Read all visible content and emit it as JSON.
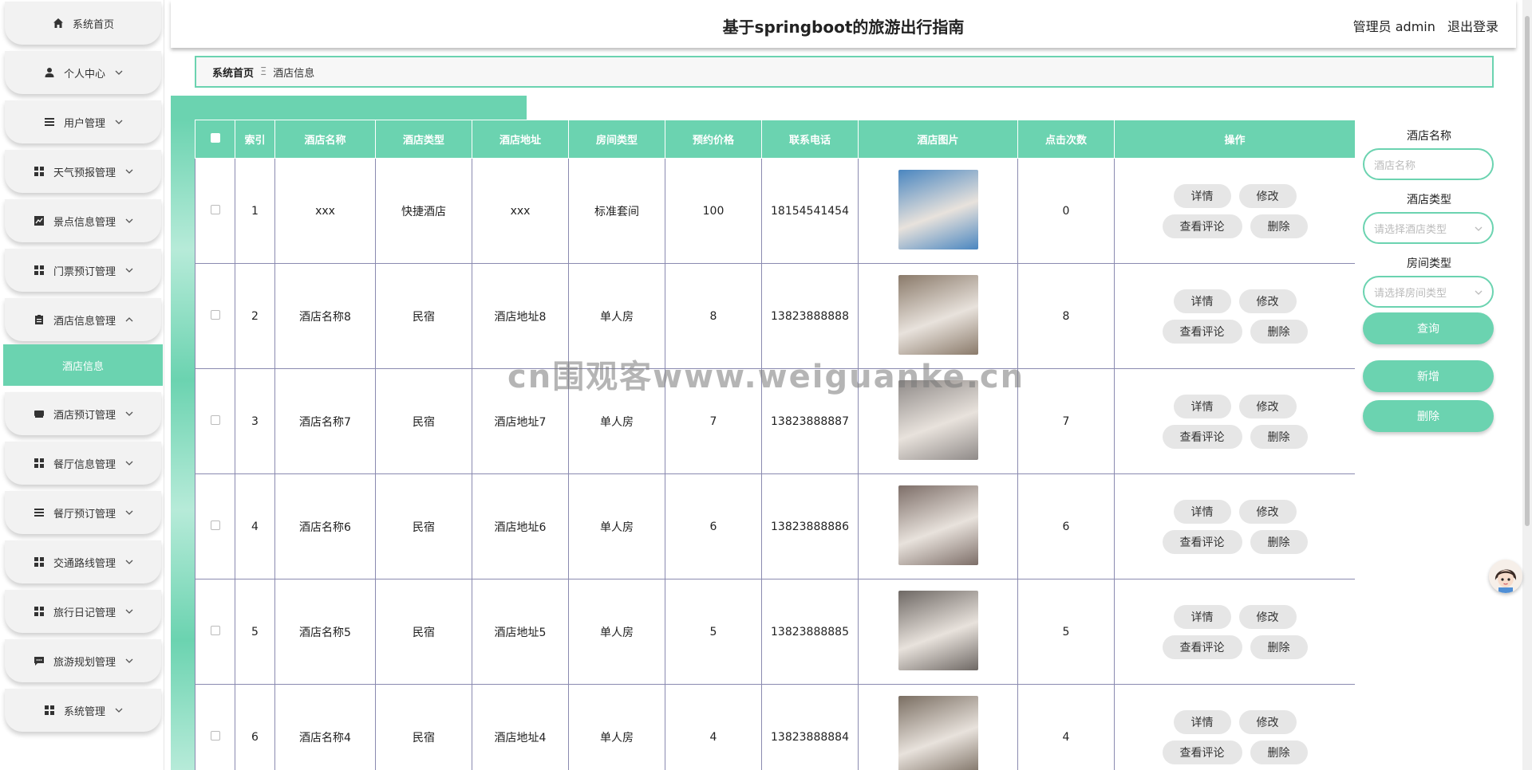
{
  "header": {
    "title": "基于springboot的旅游出行指南",
    "user_label": "管理员 admin",
    "logout_label": "退出登录"
  },
  "sidebar": {
    "items": [
      {
        "label": "系统首页",
        "icon": "home-icon",
        "has_chevron": false
      },
      {
        "label": "个人中心",
        "icon": "user-icon",
        "has_chevron": true
      },
      {
        "label": "用户管理",
        "icon": "list-icon",
        "has_chevron": true
      },
      {
        "label": "天气预报管理",
        "icon": "grid-icon",
        "has_chevron": true
      },
      {
        "label": "景点信息管理",
        "icon": "chart-icon",
        "has_chevron": true
      },
      {
        "label": "门票预订管理",
        "icon": "grid-icon",
        "has_chevron": true
      },
      {
        "label": "酒店信息管理",
        "icon": "clipboard-icon",
        "has_chevron": true,
        "expanded": true
      },
      {
        "label": "酒店预订管理",
        "icon": "drive-icon",
        "has_chevron": true
      },
      {
        "label": "餐厅信息管理",
        "icon": "grid-icon",
        "has_chevron": true
      },
      {
        "label": "餐厅预订管理",
        "icon": "list-icon",
        "has_chevron": true
      },
      {
        "label": "交通路线管理",
        "icon": "grid-icon",
        "has_chevron": true
      },
      {
        "label": "旅行日记管理",
        "icon": "grid-icon",
        "has_chevron": true
      },
      {
        "label": "旅游规划管理",
        "icon": "chat-icon",
        "has_chevron": true
      },
      {
        "label": "系统管理",
        "icon": "grid-icon",
        "has_chevron": true
      }
    ],
    "active_sub": "酒店信息"
  },
  "breadcrumb": {
    "home": "系统首页",
    "separator": "Ξ",
    "current": "酒店信息"
  },
  "table": {
    "columns": [
      "索引",
      "酒店名称",
      "酒店类型",
      "酒店地址",
      "房间类型",
      "预约价格",
      "联系电话",
      "酒店图片",
      "点击次数",
      "操作"
    ],
    "rows": [
      {
        "index": "1",
        "name": "xxx",
        "type": "快捷酒店",
        "address": "xxx",
        "room": "标准套间",
        "price": "100",
        "phone": "18154541454",
        "clicks": "0",
        "image_color": "#4a86c0"
      },
      {
        "index": "2",
        "name": "酒店名称8",
        "type": "民宿",
        "address": "酒店地址8",
        "room": "单人房",
        "price": "8",
        "phone": "13823888888",
        "clicks": "8",
        "image_color": "#8a7a6a"
      },
      {
        "index": "3",
        "name": "酒店名称7",
        "type": "民宿",
        "address": "酒店地址7",
        "room": "单人房",
        "price": "7",
        "phone": "13823888887",
        "clicks": "7",
        "image_color": "#8f8a88"
      },
      {
        "index": "4",
        "name": "酒店名称6",
        "type": "民宿",
        "address": "酒店地址6",
        "room": "单人房",
        "price": "6",
        "phone": "13823888886",
        "clicks": "6",
        "image_color": "#7d6e68"
      },
      {
        "index": "5",
        "name": "酒店名称5",
        "type": "民宿",
        "address": "酒店地址5",
        "room": "单人房",
        "price": "5",
        "phone": "13823888885",
        "clicks": "5",
        "image_color": "#6e6864"
      },
      {
        "index": "6",
        "name": "酒店名称4",
        "type": "民宿",
        "address": "酒店地址4",
        "room": "单人房",
        "price": "4",
        "phone": "13823888884",
        "clicks": "4",
        "image_color": "#7a6e62"
      }
    ],
    "actions": {
      "detail": "详情",
      "edit": "修改",
      "comments": "查看评论",
      "delete": "删除"
    }
  },
  "search": {
    "name_label": "酒店名称",
    "name_placeholder": "酒店名称",
    "type_label": "酒店类型",
    "type_placeholder": "请选择酒店类型",
    "room_label": "房间类型",
    "room_placeholder": "请选择房间类型",
    "query_button": "查询",
    "add_button": "新增",
    "delete_button": "删除"
  },
  "watermark": "cn围观客www.weiguanke.cn",
  "colors": {
    "accent": "#6bd3b0",
    "menu_bg": "#f2f2f2",
    "button_gray": "#e6e6e6"
  }
}
